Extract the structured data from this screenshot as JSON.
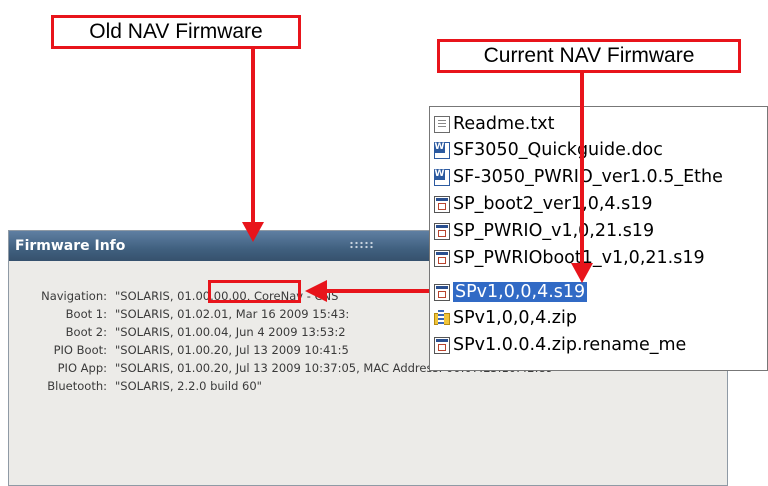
{
  "callouts": {
    "old_label": "Old NAV Firmware",
    "current_label": "Current NAV Firmware",
    "color": "#e8141b"
  },
  "firmware_panel": {
    "title": "Firmware Info",
    "rows": [
      {
        "label": "Navigation:",
        "value": "\"SOLARIS, 01.00.00.00, CoreNav - CNS"
      },
      {
        "label": "Boot 1:",
        "value": "\"SOLARIS, 01.02.01, Mar 16 2009 15:43:"
      },
      {
        "label": "Boot 2:",
        "value": "\"SOLARIS, 01.00.04, Jun 4 2009 13:53:2"
      },
      {
        "label": "PIO Boot:",
        "value": "\"SOLARIS, 01.00.20, Jul 13 2009 10:41:5"
      },
      {
        "label": "PIO App:",
        "value": "\"SOLARIS, 01.00.20, Jul 13 2009 10:37:05, MAC Address: 00:07:E3:10:42:89\""
      },
      {
        "label": "Bluetooth:",
        "value": "\"SOLARIS, 2.2.0 build 60\""
      }
    ]
  },
  "file_list": {
    "selected_color": "#316ac5",
    "items": [
      {
        "name": "Readme.txt",
        "icon": "text-file-icon"
      },
      {
        "name": "SF3050_Quickguide.doc",
        "icon": "word-document-icon"
      },
      {
        "name": "SF-3050_PWRIO_ver1.0.5_Ethe",
        "icon": "word-document-icon"
      },
      {
        "name": "SP_boot2_ver1,0,4.s19",
        "icon": "s19-file-icon"
      },
      {
        "name": "SP_PWRIO_v1,0,21.s19",
        "icon": "s19-file-icon"
      },
      {
        "name": "SP_PWRIOboot1_v1,0,21.s19",
        "icon": "s19-file-icon"
      },
      {
        "name": "SPv1,0,0,4.s19",
        "icon": "s19-file-icon",
        "selected": true
      },
      {
        "name": "SPv1,0,0,4.zip",
        "icon": "zip-folder-icon"
      },
      {
        "name": "SPv1.0.0.4.zip.rename_me",
        "icon": "s19-file-icon"
      }
    ]
  }
}
